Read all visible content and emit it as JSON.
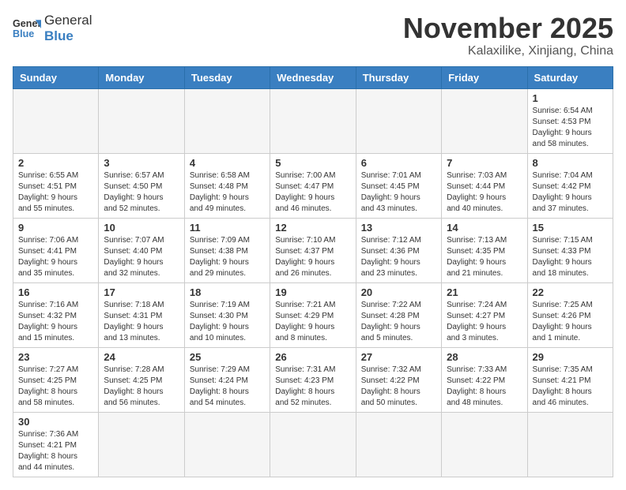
{
  "logo": {
    "text_general": "General",
    "text_blue": "Blue"
  },
  "title": "November 2025",
  "subtitle": "Kalaxilike, Xinjiang, China",
  "weekdays": [
    "Sunday",
    "Monday",
    "Tuesday",
    "Wednesday",
    "Thursday",
    "Friday",
    "Saturday"
  ],
  "weeks": [
    [
      {
        "day": "",
        "info": ""
      },
      {
        "day": "",
        "info": ""
      },
      {
        "day": "",
        "info": ""
      },
      {
        "day": "",
        "info": ""
      },
      {
        "day": "",
        "info": ""
      },
      {
        "day": "",
        "info": ""
      },
      {
        "day": "1",
        "info": "Sunrise: 6:54 AM\nSunset: 4:53 PM\nDaylight: 9 hours\nand 58 minutes."
      }
    ],
    [
      {
        "day": "2",
        "info": "Sunrise: 6:55 AM\nSunset: 4:51 PM\nDaylight: 9 hours\nand 55 minutes."
      },
      {
        "day": "3",
        "info": "Sunrise: 6:57 AM\nSunset: 4:50 PM\nDaylight: 9 hours\nand 52 minutes."
      },
      {
        "day": "4",
        "info": "Sunrise: 6:58 AM\nSunset: 4:48 PM\nDaylight: 9 hours\nand 49 minutes."
      },
      {
        "day": "5",
        "info": "Sunrise: 7:00 AM\nSunset: 4:47 PM\nDaylight: 9 hours\nand 46 minutes."
      },
      {
        "day": "6",
        "info": "Sunrise: 7:01 AM\nSunset: 4:45 PM\nDaylight: 9 hours\nand 43 minutes."
      },
      {
        "day": "7",
        "info": "Sunrise: 7:03 AM\nSunset: 4:44 PM\nDaylight: 9 hours\nand 40 minutes."
      },
      {
        "day": "8",
        "info": "Sunrise: 7:04 AM\nSunset: 4:42 PM\nDaylight: 9 hours\nand 37 minutes."
      }
    ],
    [
      {
        "day": "9",
        "info": "Sunrise: 7:06 AM\nSunset: 4:41 PM\nDaylight: 9 hours\nand 35 minutes."
      },
      {
        "day": "10",
        "info": "Sunrise: 7:07 AM\nSunset: 4:40 PM\nDaylight: 9 hours\nand 32 minutes."
      },
      {
        "day": "11",
        "info": "Sunrise: 7:09 AM\nSunset: 4:38 PM\nDaylight: 9 hours\nand 29 minutes."
      },
      {
        "day": "12",
        "info": "Sunrise: 7:10 AM\nSunset: 4:37 PM\nDaylight: 9 hours\nand 26 minutes."
      },
      {
        "day": "13",
        "info": "Sunrise: 7:12 AM\nSunset: 4:36 PM\nDaylight: 9 hours\nand 23 minutes."
      },
      {
        "day": "14",
        "info": "Sunrise: 7:13 AM\nSunset: 4:35 PM\nDaylight: 9 hours\nand 21 minutes."
      },
      {
        "day": "15",
        "info": "Sunrise: 7:15 AM\nSunset: 4:33 PM\nDaylight: 9 hours\nand 18 minutes."
      }
    ],
    [
      {
        "day": "16",
        "info": "Sunrise: 7:16 AM\nSunset: 4:32 PM\nDaylight: 9 hours\nand 15 minutes."
      },
      {
        "day": "17",
        "info": "Sunrise: 7:18 AM\nSunset: 4:31 PM\nDaylight: 9 hours\nand 13 minutes."
      },
      {
        "day": "18",
        "info": "Sunrise: 7:19 AM\nSunset: 4:30 PM\nDaylight: 9 hours\nand 10 minutes."
      },
      {
        "day": "19",
        "info": "Sunrise: 7:21 AM\nSunset: 4:29 PM\nDaylight: 9 hours\nand 8 minutes."
      },
      {
        "day": "20",
        "info": "Sunrise: 7:22 AM\nSunset: 4:28 PM\nDaylight: 9 hours\nand 5 minutes."
      },
      {
        "day": "21",
        "info": "Sunrise: 7:24 AM\nSunset: 4:27 PM\nDaylight: 9 hours\nand 3 minutes."
      },
      {
        "day": "22",
        "info": "Sunrise: 7:25 AM\nSunset: 4:26 PM\nDaylight: 9 hours\nand 1 minute."
      }
    ],
    [
      {
        "day": "23",
        "info": "Sunrise: 7:27 AM\nSunset: 4:25 PM\nDaylight: 8 hours\nand 58 minutes."
      },
      {
        "day": "24",
        "info": "Sunrise: 7:28 AM\nSunset: 4:25 PM\nDaylight: 8 hours\nand 56 minutes."
      },
      {
        "day": "25",
        "info": "Sunrise: 7:29 AM\nSunset: 4:24 PM\nDaylight: 8 hours\nand 54 minutes."
      },
      {
        "day": "26",
        "info": "Sunrise: 7:31 AM\nSunset: 4:23 PM\nDaylight: 8 hours\nand 52 minutes."
      },
      {
        "day": "27",
        "info": "Sunrise: 7:32 AM\nSunset: 4:22 PM\nDaylight: 8 hours\nand 50 minutes."
      },
      {
        "day": "28",
        "info": "Sunrise: 7:33 AM\nSunset: 4:22 PM\nDaylight: 8 hours\nand 48 minutes."
      },
      {
        "day": "29",
        "info": "Sunrise: 7:35 AM\nSunset: 4:21 PM\nDaylight: 8 hours\nand 46 minutes."
      }
    ],
    [
      {
        "day": "30",
        "info": "Sunrise: 7:36 AM\nSunset: 4:21 PM\nDaylight: 8 hours\nand 44 minutes."
      },
      {
        "day": "",
        "info": ""
      },
      {
        "day": "",
        "info": ""
      },
      {
        "day": "",
        "info": ""
      },
      {
        "day": "",
        "info": ""
      },
      {
        "day": "",
        "info": ""
      },
      {
        "day": "",
        "info": ""
      }
    ]
  ]
}
